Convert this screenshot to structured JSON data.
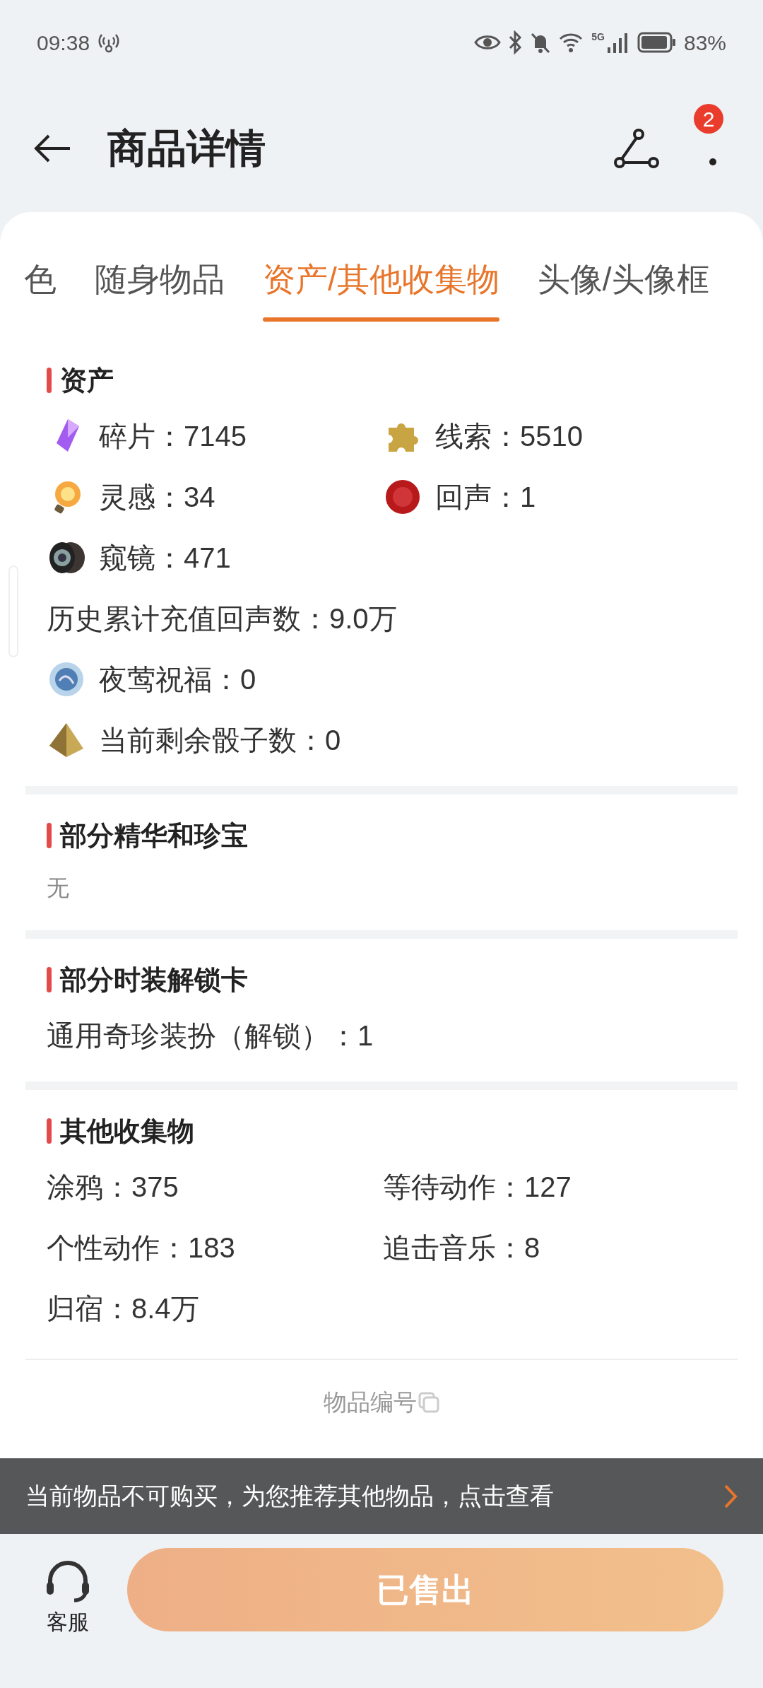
{
  "status_bar": {
    "time": "09:38",
    "battery": "83%",
    "network": "5G"
  },
  "header": {
    "title": "商品详情",
    "badge": "2"
  },
  "tabs": [
    {
      "label": "色",
      "selected": false
    },
    {
      "label": "随身物品",
      "selected": false
    },
    {
      "label": "资产/其他收集物",
      "selected": true
    },
    {
      "label": "头像/头像框",
      "selected": false
    }
  ],
  "sections": [
    {
      "title": "资产",
      "rows": [
        [
          {
            "kind": "icon",
            "text": "碎片：7145"
          },
          {
            "kind": "icon",
            "text": "线索：5510"
          }
        ],
        [
          {
            "kind": "icon",
            "text": "灵感：34"
          },
          {
            "kind": "icon",
            "text": "回声：1"
          }
        ],
        [
          {
            "kind": "icon",
            "text": "窥镜：471"
          }
        ],
        [
          {
            "kind": "text",
            "text": "历史累计充值回声数：9.0万"
          }
        ],
        [
          {
            "kind": "icon",
            "text": "夜莺祝福：0"
          }
        ],
        [
          {
            "kind": "icon",
            "text": "当前剩余骰子数：0"
          }
        ]
      ]
    },
    {
      "title": "部分精华和珍宝",
      "empty_text": "无"
    },
    {
      "title": "部分时装解锁卡",
      "rows": [
        [
          {
            "kind": "text",
            "text": "通用奇珍装扮（解锁）：1"
          }
        ]
      ]
    },
    {
      "title": "其他收集物",
      "rows": [
        [
          {
            "kind": "text",
            "text": "涂鸦：375"
          },
          {
            "kind": "text",
            "text": "等待动作：127"
          }
        ],
        [
          {
            "kind": "text",
            "text": "个性动作：183"
          },
          {
            "kind": "text",
            "text": "追击音乐：8"
          }
        ],
        [
          {
            "kind": "text",
            "text": "归宿：8.4万"
          }
        ]
      ]
    }
  ],
  "item_number_label": "物品编号",
  "banner": "当前物品不可购买，为您推荐其他物品，点击查看",
  "bottom": {
    "service_label": "客服",
    "button": "已售出"
  }
}
